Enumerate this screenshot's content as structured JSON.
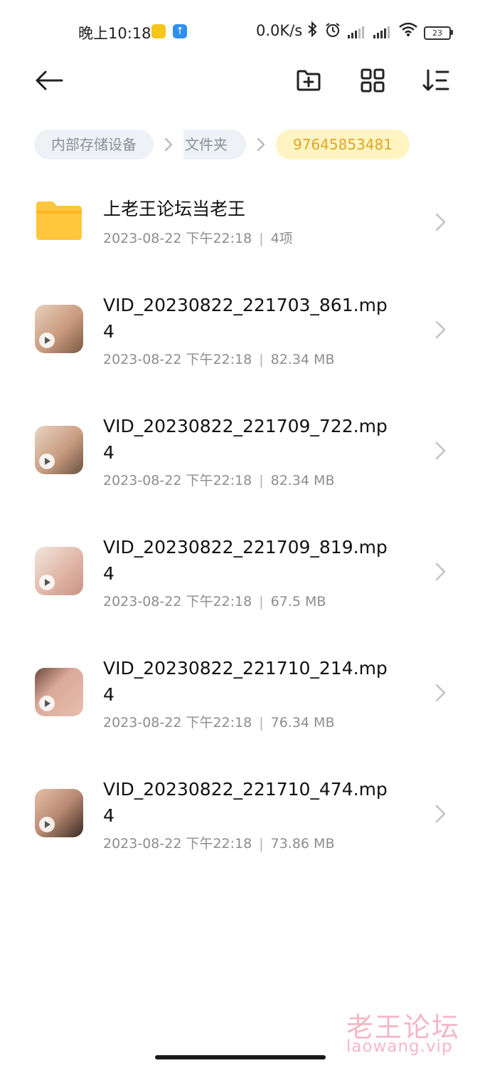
{
  "status_bar": {
    "time": "晚上10:18",
    "net_speed": "0.0K/s",
    "battery": "23",
    "icons": [
      "app-notification-icon",
      "upload-app-icon",
      "bluetooth-icon",
      "alarm-icon",
      "signal-icon",
      "signal-icon",
      "wifi-icon",
      "battery-icon"
    ]
  },
  "toolbar": {
    "icons": [
      "back-arrow-icon",
      "new-folder-icon",
      "grid-view-icon",
      "sort-icon"
    ]
  },
  "breadcrumb": [
    {
      "label": "内部存储设备"
    },
    {
      "label": "文件夹"
    },
    {
      "label": "97645853481"
    }
  ],
  "folder": {
    "name": "上老王论坛当老王",
    "date": "2023-08-22 下午22:18",
    "info": "4项"
  },
  "videos": [
    {
      "name": "VID_20230822_221703_861.mp4",
      "date": "2023-08-22 下午22:18",
      "size": "82.34 MB"
    },
    {
      "name": "VID_20230822_221709_722.mp4",
      "date": "2023-08-22 下午22:18",
      "size": "82.34 MB"
    },
    {
      "name": "VID_20230822_221709_819.mp4",
      "date": "2023-08-22 下午22:18",
      "size": "67.5 MB"
    },
    {
      "name": "VID_20230822_221710_214.mp4",
      "date": "2023-08-22 下午22:18",
      "size": "76.34 MB"
    },
    {
      "name": "VID_20230822_221710_474.mp4",
      "date": "2023-08-22 下午22:18",
      "size": "73.86 MB"
    }
  ],
  "watermark": {
    "title": "老王论坛",
    "url": "laowang.vip"
  },
  "colors": {
    "folder": "#ffc53d",
    "active_crumb_bg": "#fff4c2",
    "active_crumb_text": "#e0a624",
    "crumb_bg": "#eef1f5"
  }
}
